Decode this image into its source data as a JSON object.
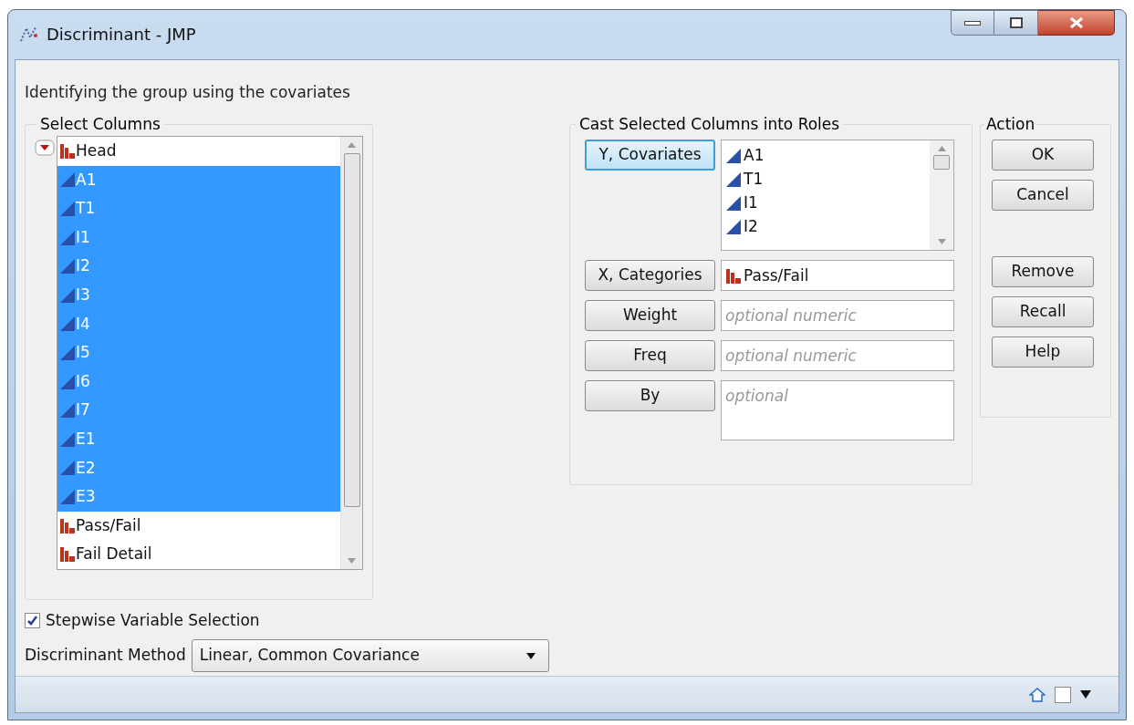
{
  "window": {
    "title": "Discriminant - JMP"
  },
  "description": "Identifying the group using the covariates",
  "select_columns": {
    "title": "Select Columns",
    "columns": [
      {
        "name": "Head",
        "kind": "nominal",
        "selected": false
      },
      {
        "name": "A1",
        "kind": "continuous",
        "selected": true
      },
      {
        "name": "T1",
        "kind": "continuous",
        "selected": true
      },
      {
        "name": "I1",
        "kind": "continuous",
        "selected": true
      },
      {
        "name": "I2",
        "kind": "continuous",
        "selected": true
      },
      {
        "name": "I3",
        "kind": "continuous",
        "selected": true
      },
      {
        "name": "I4",
        "kind": "continuous",
        "selected": true
      },
      {
        "name": "I5",
        "kind": "continuous",
        "selected": true
      },
      {
        "name": "I6",
        "kind": "continuous",
        "selected": true
      },
      {
        "name": "I7",
        "kind": "continuous",
        "selected": true
      },
      {
        "name": "E1",
        "kind": "continuous",
        "selected": true
      },
      {
        "name": "E2",
        "kind": "continuous",
        "selected": true
      },
      {
        "name": "E3",
        "kind": "continuous",
        "selected": true
      },
      {
        "name": "Pass/Fail",
        "kind": "nominal",
        "selected": false
      },
      {
        "name": "Fail Detail",
        "kind": "nominal",
        "selected": false
      }
    ]
  },
  "cast_roles": {
    "title": "Cast Selected Columns into Roles",
    "roles": [
      {
        "button": "Y, Covariates",
        "focused": true,
        "kind": "list",
        "items": [
          {
            "name": "A1",
            "kind": "continuous"
          },
          {
            "name": "T1",
            "kind": "continuous"
          },
          {
            "name": "I1",
            "kind": "continuous"
          },
          {
            "name": "I2",
            "kind": "continuous"
          }
        ]
      },
      {
        "button": "X, Categories",
        "focused": false,
        "kind": "single",
        "items": [
          {
            "name": "Pass/Fail",
            "kind": "nominal"
          }
        ]
      },
      {
        "button": "Weight",
        "focused": false,
        "kind": "single",
        "placeholder": "optional numeric"
      },
      {
        "button": "Freq",
        "focused": false,
        "kind": "single",
        "placeholder": "optional numeric"
      },
      {
        "button": "By",
        "focused": false,
        "kind": "tall",
        "placeholder": "optional"
      }
    ]
  },
  "action": {
    "title": "Action",
    "button_groups": [
      [
        "OK",
        "Cancel"
      ],
      [
        "Remove",
        "Recall",
        "Help"
      ]
    ]
  },
  "stepwise": {
    "label": "Stepwise Variable Selection",
    "checked": true
  },
  "method": {
    "label": "Discriminant Method",
    "value": "Linear, Common Covariance"
  }
}
